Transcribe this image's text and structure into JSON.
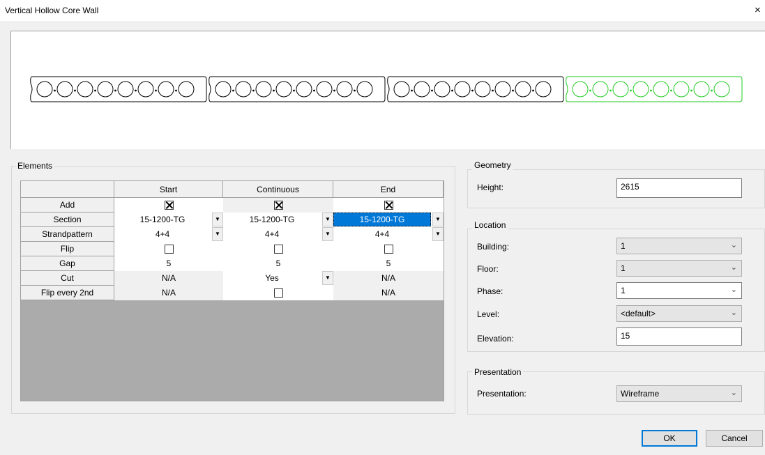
{
  "window": {
    "title": "Vertical Hollow Core Wall",
    "close_glyph": "×"
  },
  "preview": {
    "panels": [
      {
        "color": "#000000"
      },
      {
        "color": "#000000"
      },
      {
        "color": "#000000"
      },
      {
        "color": "#22cc22"
      }
    ]
  },
  "elements": {
    "group_label": "Elements",
    "columns": [
      "Start",
      "Continuous",
      "End"
    ],
    "rows": [
      {
        "label": "Add",
        "cells": [
          {
            "kind": "check",
            "checked": true
          },
          {
            "kind": "check",
            "checked": true
          },
          {
            "kind": "check",
            "checked": true
          }
        ]
      },
      {
        "label": "Section",
        "cells": [
          {
            "kind": "combo",
            "text": "15-1200-TG"
          },
          {
            "kind": "combo",
            "text": "15-1200-TG"
          },
          {
            "kind": "combo",
            "text": "15-1200-TG",
            "selected": true
          }
        ]
      },
      {
        "label": "Strandpattern",
        "cells": [
          {
            "kind": "combo",
            "text": "4+4"
          },
          {
            "kind": "combo",
            "text": "4+4"
          },
          {
            "kind": "combo",
            "text": "4+4"
          }
        ]
      },
      {
        "label": "Flip",
        "cells": [
          {
            "kind": "check",
            "checked": false
          },
          {
            "kind": "check",
            "checked": false
          },
          {
            "kind": "check",
            "checked": false
          }
        ]
      },
      {
        "label": "Gap",
        "cells": [
          {
            "kind": "text",
            "text": "5"
          },
          {
            "kind": "text",
            "text": "5"
          },
          {
            "kind": "text",
            "text": "5"
          }
        ]
      },
      {
        "label": "Cut",
        "cells": [
          {
            "kind": "na",
            "text": "N/A"
          },
          {
            "kind": "combo",
            "text": "Yes"
          },
          {
            "kind": "na",
            "text": "N/A"
          }
        ]
      },
      {
        "label": "Flip every 2nd",
        "cells": [
          {
            "kind": "na",
            "text": "N/A"
          },
          {
            "kind": "check",
            "checked": false
          },
          {
            "kind": "na",
            "text": "N/A"
          }
        ]
      }
    ]
  },
  "geometry": {
    "group_label": "Geometry",
    "height_label": "Height:",
    "height_value": "2615"
  },
  "location": {
    "group_label": "Location",
    "building_label": "Building:",
    "building_value": "1",
    "floor_label": "Floor:",
    "floor_value": "1",
    "phase_label": "Phase:",
    "phase_value": "1",
    "level_label": "Level:",
    "level_value": "<default>",
    "elevation_label": "Elevation:",
    "elevation_value": "15"
  },
  "presentation": {
    "group_label": "Presentation",
    "presentation_label": "Presentation:",
    "presentation_value": "Wireframe"
  },
  "buttons": {
    "ok": "OK",
    "cancel": "Cancel"
  },
  "colors": {
    "selection": "#0078d7",
    "grid_grey": "#ababab",
    "accent_green": "#22cc22"
  }
}
